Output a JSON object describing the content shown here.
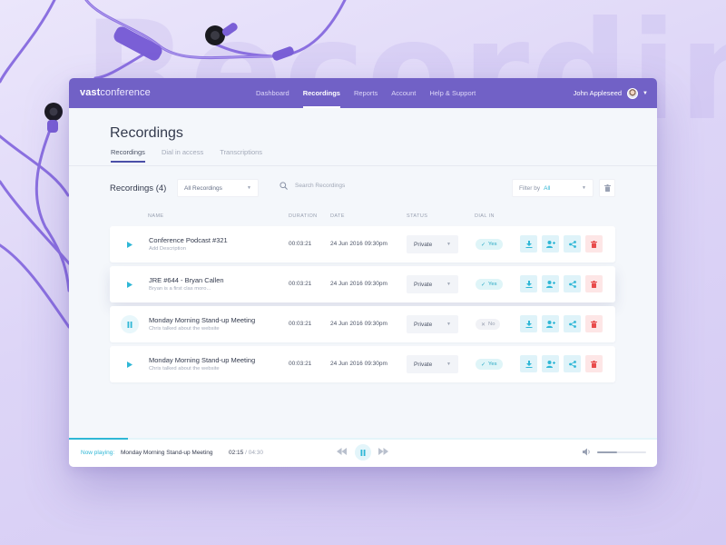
{
  "background": {
    "word": "Recording"
  },
  "app": {
    "brand_bold": "vast",
    "brand_rest": "conference",
    "nav": [
      "Dashboard",
      "Recordings",
      "Reports",
      "Account",
      "Help & Support"
    ],
    "nav_active": 1,
    "user_name": "John Appleseed"
  },
  "page": {
    "title": "Recordings",
    "tabs": [
      "Recordings",
      "Dial in access",
      "Transcriptions"
    ],
    "active_tab": 0
  },
  "toolbar": {
    "count_label": "Recordings (4)",
    "type_select": "All Recordings",
    "search_placeholder": "Search Recordings",
    "filter_label": "Filter by",
    "filter_value": "All"
  },
  "table": {
    "headers": {
      "name": "NAME",
      "duration": "DURATION",
      "date": "DATE",
      "status": "STATUS",
      "dial": "DIAL IN"
    },
    "rows": [
      {
        "title": "Conference Podcast #321",
        "desc": "Add Description",
        "duration": "00:03:21",
        "date": "24 Jun 2016 09:30pm",
        "status": "Private",
        "dial_in": "Yes",
        "playing": false
      },
      {
        "title": "JRE #644 - Bryan Callen",
        "desc": "Bryan is a first clas moro...",
        "duration": "00:03:21",
        "date": "24 Jun 2016 09:30pm",
        "status": "Private",
        "dial_in": "Yes",
        "playing": false
      },
      {
        "title": "Monday Morning Stand-up Meeting",
        "desc": "Chris talked about the website",
        "duration": "00:03:21",
        "date": "24 Jun 2016 09:30pm",
        "status": "Private",
        "dial_in": "No",
        "playing": true
      },
      {
        "title": "Monday Morning Stand-up Meeting",
        "desc": "Chris talked about the website",
        "duration": "00:03:21",
        "date": "24 Jun 2016 09:30pm",
        "status": "Private",
        "dial_in": "Yes",
        "playing": false
      }
    ]
  },
  "player": {
    "now_playing_label": "Now playing:",
    "track_title": "Monday Morning Stand-up Meeting",
    "current_time": "02:15",
    "total_time": "/ 04:30",
    "progress": 0.1,
    "volume": 0.4
  },
  "colors": {
    "brand": "#7161c6",
    "accent": "#2fb7d6",
    "danger": "#e84b4b",
    "cable": "#8b70e0"
  },
  "icons": [
    "search-icon",
    "trash-icon",
    "play-icon",
    "pause-icon",
    "download-icon",
    "share-user-icon",
    "share-icon",
    "delete-icon",
    "rewind-icon",
    "forward-icon",
    "volume-icon",
    "chevron-down-icon",
    "check-icon"
  ]
}
